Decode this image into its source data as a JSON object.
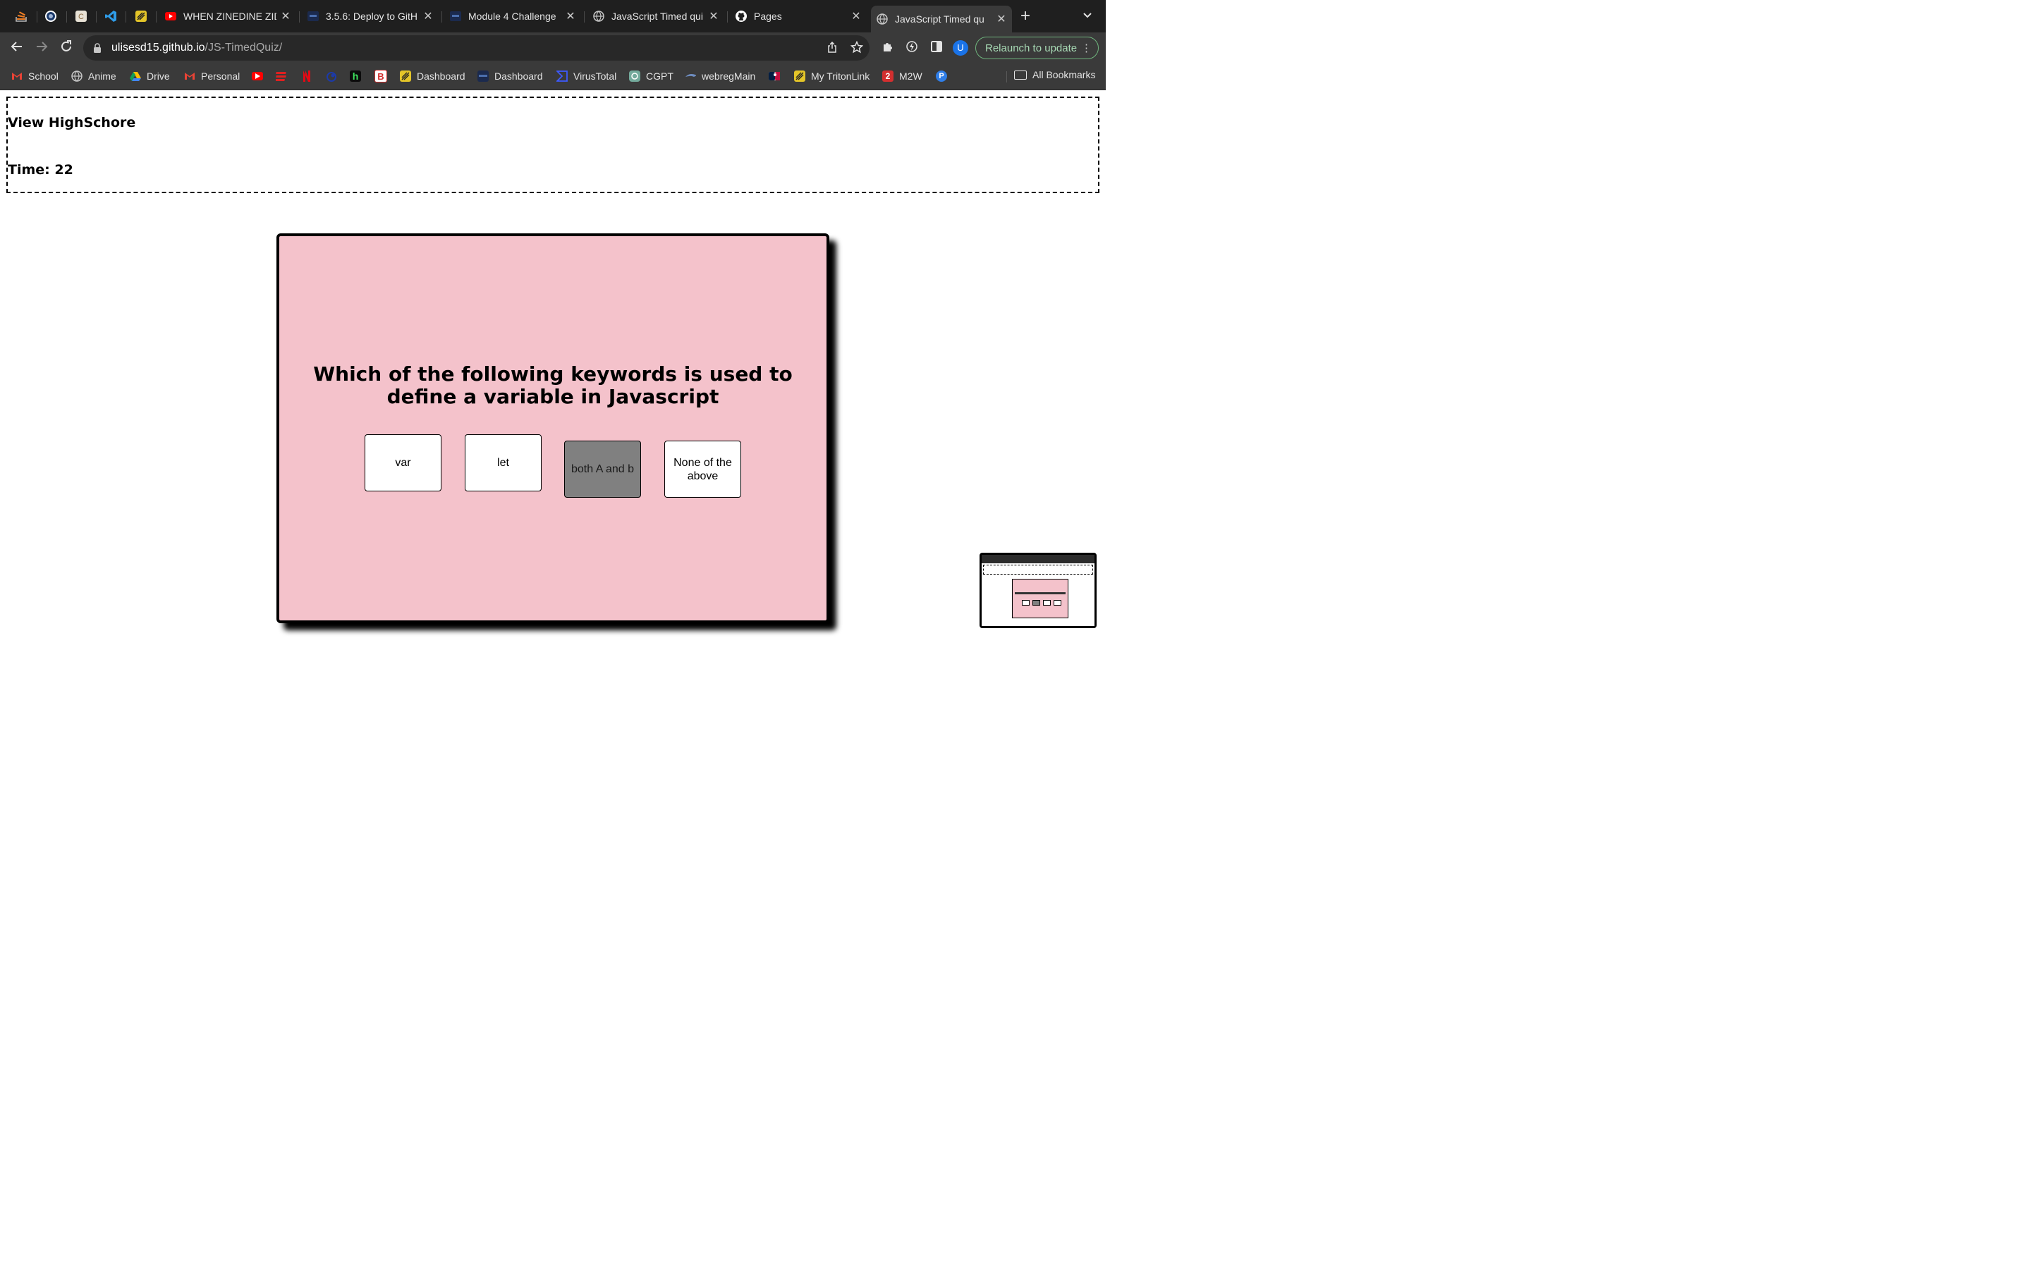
{
  "browser": {
    "tabs": [
      {
        "title": "WHEN ZINEDINE ZID",
        "favicon": "youtube-icon",
        "active": false
      },
      {
        "title": "3.5.6: Deploy to GitH",
        "favicon": "bootcamp-icon",
        "active": false
      },
      {
        "title": "Module 4 Challenge",
        "favicon": "bootcamp-icon",
        "active": false
      },
      {
        "title": "JavaScript Timed qui",
        "favicon": "globe-icon",
        "active": false
      },
      {
        "title": "Pages",
        "favicon": "github-icon",
        "active": false
      },
      {
        "title": "JavaScript Timed qu",
        "favicon": "globe-icon",
        "active": true
      }
    ],
    "url_host": "ulisesd15.github.io",
    "url_path": "/JS-TimedQuiz/",
    "relaunch_label": "Relaunch to update",
    "profile_initial": "U",
    "bookmarks": [
      {
        "label": "School",
        "icon": "gmail-icon"
      },
      {
        "label": "Anime",
        "icon": "globe-icon"
      },
      {
        "label": "Drive",
        "icon": "drive-icon"
      },
      {
        "label": "Personal",
        "icon": "gmail-icon"
      },
      {
        "label": "",
        "icon": "youtube-icon"
      },
      {
        "label": "",
        "icon": "stack-icon"
      },
      {
        "label": "",
        "icon": "netflix-icon"
      },
      {
        "label": "",
        "icon": "crunchy-icon"
      },
      {
        "label": "",
        "icon": "h-icon"
      },
      {
        "label": "",
        "icon": "b-icon"
      },
      {
        "label": "Dashboard",
        "icon": "canvas-icon"
      },
      {
        "label": "Dashboard",
        "icon": "bootcamp-icon"
      },
      {
        "label": "VirusTotal",
        "icon": "virustotal-icon"
      },
      {
        "label": "CGPT",
        "icon": "openai-icon"
      },
      {
        "label": "webregMain",
        "icon": "triton-icon"
      },
      {
        "label": "",
        "icon": "mlb-icon"
      },
      {
        "label": "My TritonLink",
        "icon": "canvas-icon"
      },
      {
        "label": "M2W",
        "icon": "m2w-icon"
      },
      {
        "label": "",
        "icon": "p-icon"
      }
    ],
    "all_bookmarks_label": "All Bookmarks"
  },
  "page": {
    "highscore_link": "View HighSchore",
    "timer_label": "Time: 22",
    "question": "Which of the following keywords is used to define a variable in Javascript",
    "choices": [
      "var",
      "let",
      "both A and b",
      "None of the above"
    ],
    "hovered_choice_index": 2,
    "hover_color": "#808080",
    "card_color": "#f4c2cb"
  }
}
